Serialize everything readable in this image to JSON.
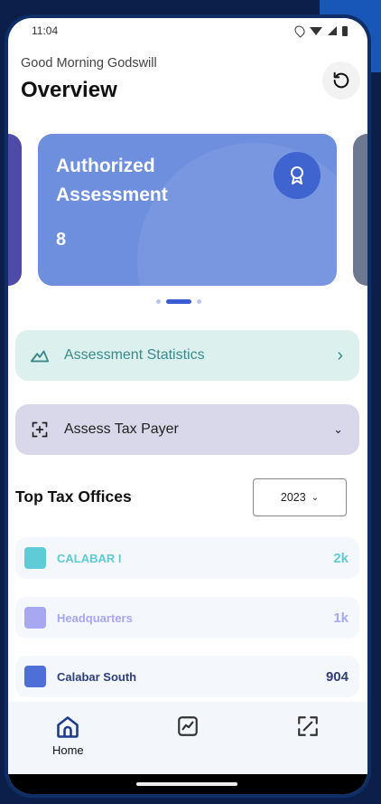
{
  "status_bar": {
    "time": "11:04"
  },
  "header": {
    "greeting": "Good Morning  Godswill",
    "title": "Overview",
    "refresh_icon": "refresh-icon"
  },
  "carousel": {
    "card": {
      "title": "Authorized Assessment",
      "count": "8",
      "icon": "award-badge-icon"
    },
    "pages": 3,
    "active_page": 2
  },
  "actions": {
    "stats_label": "Assessment Statistics",
    "assess_label": "Assess Tax Payer"
  },
  "top_offices": {
    "title": "Top Tax Offices",
    "year": "2023",
    "items": [
      {
        "name": "CALABAR I",
        "value": "2k",
        "color": "#5ecbd7"
      },
      {
        "name": "Headquarters",
        "value": "1k",
        "color": "#a7a7f2"
      },
      {
        "name": "Calabar South",
        "value": "904",
        "color": "#4e6ed8"
      }
    ]
  },
  "nav": {
    "home_label": "Home"
  },
  "colors": {
    "card": "#6e8ede",
    "accent": "#3b5bd1",
    "stats_row": "#dcf0ee",
    "assess_row": "#d8d8ea"
  }
}
